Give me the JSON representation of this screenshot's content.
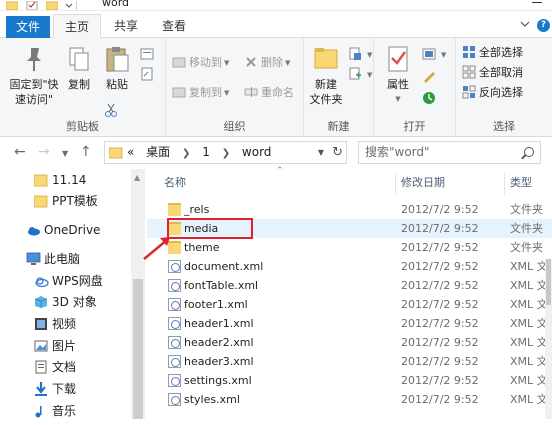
{
  "window": {
    "title": "word"
  },
  "ribbon_tabs": [
    {
      "label": "文件"
    },
    {
      "label": "主页"
    },
    {
      "label": "共享"
    },
    {
      "label": "查看"
    }
  ],
  "ribbon": {
    "clipboard": {
      "pin_label": "固定到\"快\n速访问\"",
      "copy_label": "复制",
      "paste_label": "粘贴",
      "group_label": "剪贴板"
    },
    "organize": {
      "move_to_label": "移动到",
      "copy_to_label": "复制到",
      "delete_label": "删除",
      "rename_label": "重命名",
      "group_label": "组织"
    },
    "new": {
      "new_folder_label": "新建\n文件夹",
      "group_label": "新建"
    },
    "open": {
      "properties_label": "属性",
      "group_label": "打开"
    },
    "select": {
      "select_all_label": "全部选择",
      "select_none_label": "全部取消",
      "invert_label": "反向选择",
      "group_label": "选择"
    }
  },
  "address_bar": {
    "overflow": "«",
    "crumbs": [
      "桌面",
      "1",
      "word"
    ],
    "search_placeholder": "搜索\"word\""
  },
  "nav_pane": {
    "items": [
      {
        "label": "11.14",
        "icon": "folder-icon"
      },
      {
        "label": "PPT模板",
        "icon": "folder-icon"
      },
      {
        "label": "OneDrive",
        "icon": "cloud-icon"
      },
      {
        "label": "此电脑",
        "icon": "computer-icon"
      },
      {
        "label": "WPS网盘",
        "icon": "cloud-icon"
      },
      {
        "label": "3D 对象",
        "icon": "cube-icon"
      },
      {
        "label": "视频",
        "icon": "video-icon"
      },
      {
        "label": "图片",
        "icon": "picture-icon"
      },
      {
        "label": "文档",
        "icon": "document-icon"
      },
      {
        "label": "下载",
        "icon": "download-icon"
      },
      {
        "label": "音乐",
        "icon": "music-icon"
      }
    ]
  },
  "file_list": {
    "columns": {
      "name": "名称",
      "date": "修改日期",
      "type": "类型"
    },
    "rows": [
      {
        "name": "_rels",
        "date": "2012/7/2 9:52",
        "type": "文件夹",
        "kind": "folder"
      },
      {
        "name": "media",
        "date": "2012/7/2 9:52",
        "type": "文件夹",
        "kind": "folder"
      },
      {
        "name": "theme",
        "date": "2012/7/2 9:52",
        "type": "文件夹",
        "kind": "folder"
      },
      {
        "name": "document.xml",
        "date": "2012/7/2 9:52",
        "type": "XML 文",
        "kind": "xml"
      },
      {
        "name": "fontTable.xml",
        "date": "2012/7/2 9:52",
        "type": "XML 文",
        "kind": "xml"
      },
      {
        "name": "footer1.xml",
        "date": "2012/7/2 9:52",
        "type": "XML 文",
        "kind": "xml"
      },
      {
        "name": "header1.xml",
        "date": "2012/7/2 9:52",
        "type": "XML 文",
        "kind": "xml"
      },
      {
        "name": "header2.xml",
        "date": "2012/7/2 9:52",
        "type": "XML 文",
        "kind": "xml"
      },
      {
        "name": "header3.xml",
        "date": "2012/7/2 9:52",
        "type": "XML 文",
        "kind": "xml"
      },
      {
        "name": "settings.xml",
        "date": "2012/7/2 9:52",
        "type": "XML 文",
        "kind": "xml"
      },
      {
        "name": "styles.xml",
        "date": "2012/7/2 9:52",
        "type": "XML 文",
        "kind": "xml"
      }
    ]
  },
  "colors": {
    "accent": "#1979ca",
    "highlight": "#e0232a",
    "folder": "#f8d775"
  }
}
